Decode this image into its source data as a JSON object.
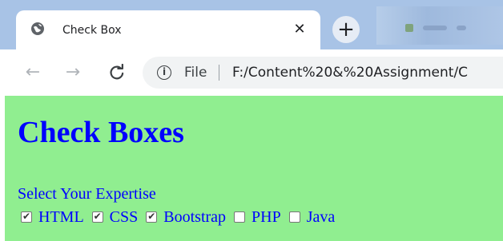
{
  "browser": {
    "tab": {
      "title": "Check Box",
      "close_glyph": "✕"
    },
    "new_tab_glyph": "+",
    "toolbar": {
      "back_glyph": "←",
      "forward_glyph": "→",
      "reload_glyph": "C",
      "info_glyph": "i",
      "scheme_label": "File",
      "url": "F:/Content%20&%20Assignment/C"
    }
  },
  "page": {
    "background": "#90ee90",
    "text_color": "#0000ff",
    "title": "Check Boxes",
    "prompt": "Select Your Expertise",
    "options": [
      {
        "label": "HTML",
        "checked": true
      },
      {
        "label": "CSS",
        "checked": true
      },
      {
        "label": "Bootstrap",
        "checked": true
      },
      {
        "label": "PHP",
        "checked": false
      },
      {
        "label": "Java",
        "checked": false
      }
    ]
  },
  "icons": {
    "favicon": "globe-icon",
    "close": "close-icon",
    "new_tab": "plus-icon",
    "back": "arrow-left-icon",
    "forward": "arrow-right-icon",
    "reload": "reload-icon",
    "info": "info-icon"
  }
}
